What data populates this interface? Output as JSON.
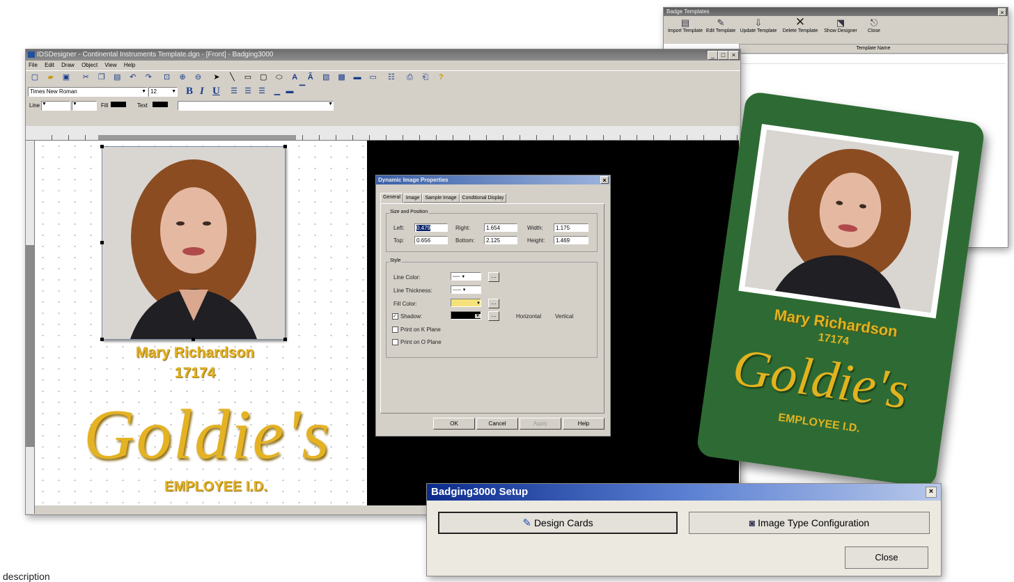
{
  "designer": {
    "title": "IDSDesigner - Continental Instruments Template.dgn - [Front] - Badging3000",
    "menu": [
      "File",
      "Edit",
      "Draw",
      "Object",
      "View",
      "Help"
    ],
    "font_name": "Times New Roman",
    "font_size": "12",
    "line_label": "Line",
    "fill_label": "Fill",
    "text_label": "Text",
    "card_name": "Mary Richardson",
    "card_number": "17174",
    "logo_text": "Goldie's",
    "caption": "EMPLOYEE I.D."
  },
  "dialog": {
    "title": "Dynamic Image Properties",
    "tabs": [
      "General",
      "Image",
      "Sample Image",
      "Conditional Display"
    ],
    "size_group": "Size and Position",
    "left_label": "Left:",
    "left_value": "0.479",
    "right_label": "Right:",
    "right_value": "1.654",
    "width_label": "Width:",
    "width_value": "1.175",
    "top_label": "Top:",
    "top_value": "0.656",
    "bottom_label": "Bottom:",
    "bottom_value": "2.125",
    "height_label": "Height:",
    "height_value": "1.469",
    "style_group": "Style",
    "line_color": "Line Color:",
    "line_thickness": "Line Thickness:",
    "fill_color": "Fill Color:",
    "shadow": "Shadow:",
    "horizontal": "Horizontal",
    "vertical": "Vertical",
    "print_k": "Print on K Plane",
    "print_o": "Print on O Plane",
    "ok": "OK",
    "cancel": "Cancel",
    "apply": "Apply",
    "help": "Help"
  },
  "badge_templates": {
    "title": "Badge Templates",
    "buttons": [
      "Import Template",
      "Edit Template",
      "Update Template",
      "Delete Template",
      "Show Designer",
      "Close"
    ],
    "column": "Template Name"
  },
  "card": {
    "name": "Mary Richardson",
    "number": "17174",
    "logo": "Goldie's",
    "caption": "EMPLOYEE I.D."
  },
  "setup": {
    "title": "Badging3000 Setup",
    "design_cards": "Design Cards",
    "image_type": "Image Type Configuration",
    "close": "Close"
  },
  "footer_text": "description",
  "colors": {
    "card_green": "#2e6b34",
    "gold": "#e0b31f"
  }
}
